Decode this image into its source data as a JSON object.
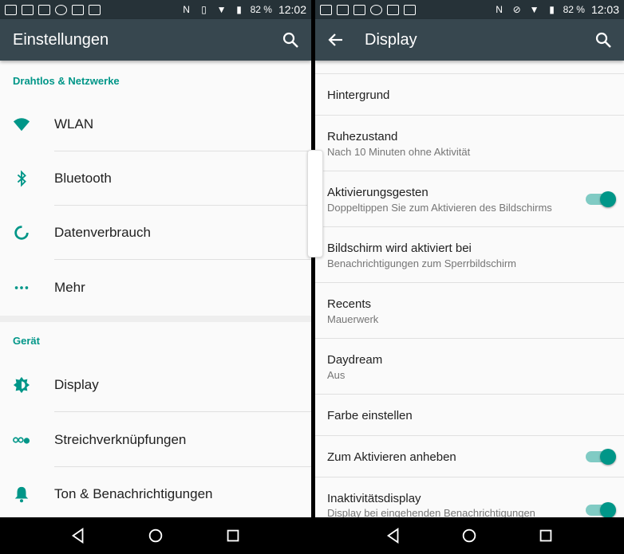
{
  "status_left": {
    "battery": "82 %",
    "clock": "12:02"
  },
  "status_right": {
    "battery": "82 %",
    "clock": "12:03"
  },
  "settings": {
    "title": "Einstellungen",
    "sections": [
      {
        "header": "Drahtlos & Netzwerke",
        "items": [
          "WLAN",
          "Bluetooth",
          "Datenverbrauch",
          "Mehr"
        ]
      },
      {
        "header": "Gerät",
        "items": [
          "Display",
          "Streichverknüpfungen",
          "Ton & Benachrichtigungen"
        ]
      }
    ]
  },
  "display": {
    "title": "Display",
    "items": [
      {
        "title": "Hintergrund"
      },
      {
        "title": "Ruhezustand",
        "subtitle": "Nach 10 Minuten ohne Aktivität"
      },
      {
        "title": "Aktivierungsgesten",
        "subtitle": "Doppeltippen Sie zum Aktivieren des Bildschirms",
        "toggle": true
      },
      {
        "title": "Bildschirm wird aktiviert bei",
        "subtitle": "Benachrichtigungen zum Sperrbildschirm"
      },
      {
        "title": "Recents",
        "subtitle": "Mauerwerk"
      },
      {
        "title": "Daydream",
        "subtitle": "Aus"
      },
      {
        "title": "Farbe einstellen"
      },
      {
        "title": "Zum Aktivieren anheben",
        "toggle": true
      },
      {
        "title": "Inaktivitätsdisplay",
        "subtitle": "Display bei eingehenden Benachrichtigungen",
        "toggle": true
      }
    ]
  },
  "colors": {
    "accent": "#009688",
    "appbar": "#37474f",
    "statusbar": "#263238"
  }
}
